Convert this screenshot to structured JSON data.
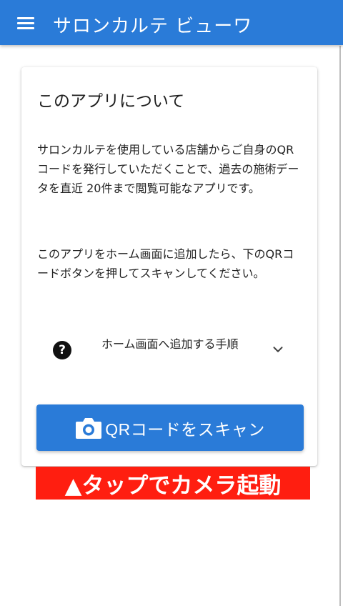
{
  "appbar": {
    "title": "サロンカルテ ビューワ",
    "menu_icon": "hamburger-menu-icon",
    "color": "#2a7bd8"
  },
  "about_card": {
    "title": "このアプリについて",
    "paragraph1": "サロンカルテを使用している店舗からご自身のQRコードを発行していただくことで、過去の施術データを直近 20件まで閲覧可能なアプリです。",
    "paragraph2": "このアプリをホーム画面に追加したら、下のQRコードボタンを押してスキャンしてください。",
    "expander": {
      "icon": "help-circle-icon",
      "label": "ホーム画面へ追加する手順",
      "chevron": "chevron-down-icon"
    },
    "scan_button": {
      "icon": "camera-icon",
      "label": "QRコードをスキャン"
    }
  },
  "banner": {
    "text": "▲タップでカメラ起動",
    "color": "#ff1e10"
  }
}
